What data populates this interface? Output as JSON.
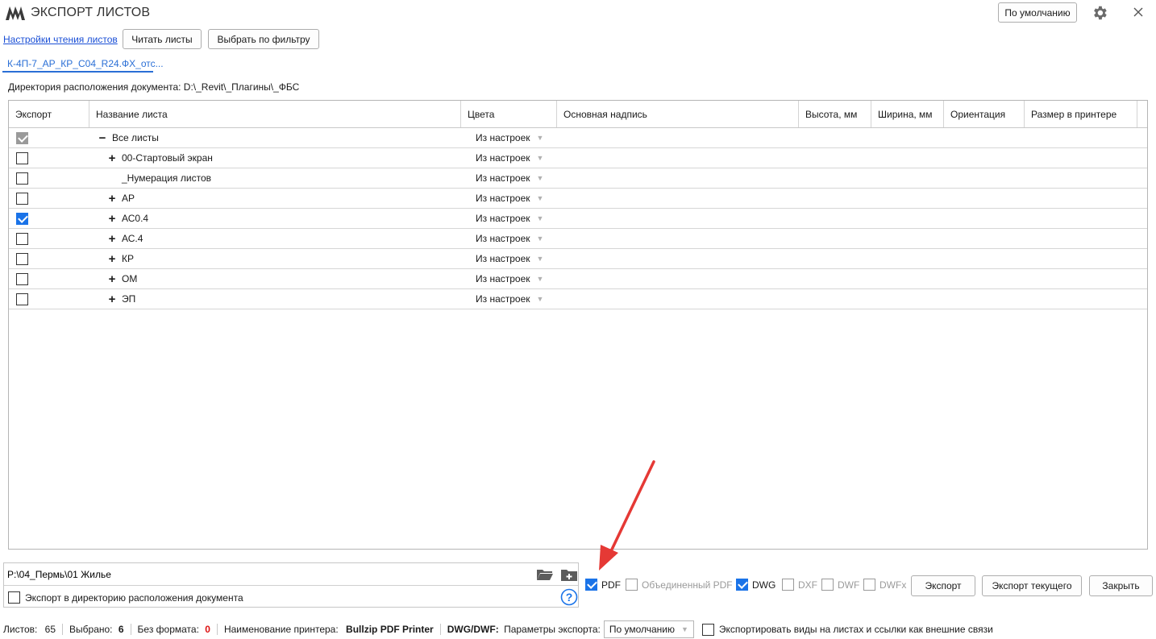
{
  "window": {
    "title": "ЭКСПОРТ ЛИСТОВ",
    "default_button": "По умолчанию"
  },
  "toolbar": {
    "read_settings_link": "Настройки чтения листов",
    "read_sheets_button": "Читать листы",
    "filter_button": "Выбрать по фильтру"
  },
  "tabs": [
    {
      "label": "К-4П-7_АР_КР_С04_R24.ФХ_отс..."
    }
  ],
  "document_dir": "Директория расположения документа: D:\\_Revit\\_Плагины\\_ФБС",
  "grid": {
    "columns": [
      "Экспорт",
      "Название листа",
      "Цвета",
      "Основная надпись",
      "Высота, мм",
      "Ширина, мм",
      "Ориентация",
      "Размер в принтере"
    ],
    "rows": [
      {
        "checked": "indeterminate",
        "expander": "−",
        "name": "Все листы",
        "color": "Из настроек"
      },
      {
        "checked": "unchecked",
        "expander": "+",
        "name": "00-Стартовый экран",
        "color": "Из настроек"
      },
      {
        "checked": "unchecked",
        "expander": "",
        "name": "_Нумерация листов",
        "color": "Из настроек"
      },
      {
        "checked": "unchecked",
        "expander": "+",
        "name": "АР",
        "color": "Из настроек"
      },
      {
        "checked": "checked",
        "expander": "+",
        "name": "АС0.4",
        "color": "Из настроек"
      },
      {
        "checked": "unchecked",
        "expander": "+",
        "name": "АС.4",
        "color": "Из настроек"
      },
      {
        "checked": "unchecked",
        "expander": "+",
        "name": "КР",
        "color": "Из настроек"
      },
      {
        "checked": "unchecked",
        "expander": "+",
        "name": "ОМ",
        "color": "Из настроек"
      },
      {
        "checked": "unchecked",
        "expander": "+",
        "name": "ЭП",
        "color": "Из настроек"
      }
    ]
  },
  "export_path": {
    "value": "P:\\04_Пермь\\01 Жилье",
    "to_doc_dir_label": "Экспорт в директорию расположения документа"
  },
  "formats": {
    "pdf": {
      "label": "PDF",
      "checked": true
    },
    "merged_pdf": {
      "label": "Объединенный PDF",
      "checked": false
    },
    "dwg": {
      "label": "DWG",
      "checked": true
    },
    "dxf": {
      "label": "DXF",
      "checked": false
    },
    "dwf": {
      "label": "DWF",
      "checked": false
    },
    "dwfx": {
      "label": "DWFx",
      "checked": false
    }
  },
  "actions": {
    "export": "Экспорт",
    "export_current": "Экспорт текущего",
    "close": "Закрыть"
  },
  "status": {
    "sheets_label": "Листов:",
    "sheets_value": "65",
    "selected_label": "Выбрано:",
    "selected_value": "6",
    "no_format_label": "Без формата:",
    "no_format_value": "0",
    "printer_label": "Наименование принтера:",
    "printer_value": "Bullzip PDF Printer",
    "dwg_label": "DWG/DWF:",
    "params_label": "Параметры экспорта:",
    "params_value": "По умолчанию",
    "external_links_label": "Экспортировать виды на листах и ссылки как внешние связи"
  },
  "colors": {
    "accent": "#1a73e8",
    "annotation_arrow": "#e53935",
    "error": "#dd1111"
  }
}
